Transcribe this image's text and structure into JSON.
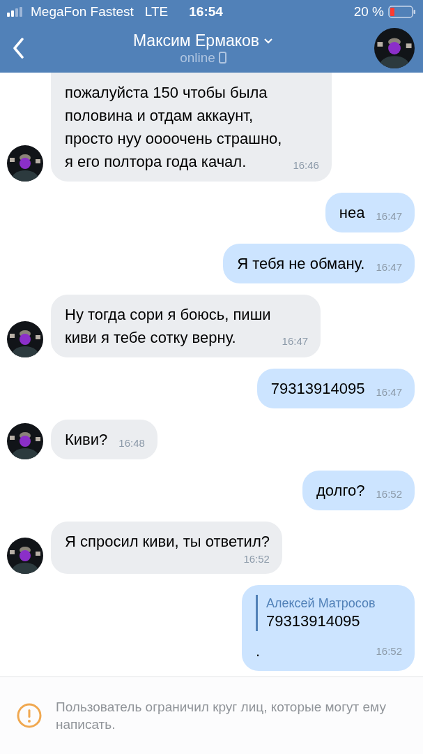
{
  "status_bar": {
    "carrier": "MegaFon Fastest",
    "network": "LTE",
    "time": "16:54",
    "battery": "20 %"
  },
  "header": {
    "title": "Максим Ермаков",
    "status": "online"
  },
  "messages": [
    {
      "outgoing": false,
      "kind": "text",
      "text": "пожалуйста 150 чтобы была\nполовина и отдам аккаунт,\nпросто нуу оооочень страшно,\nя его полтора года качал.",
      "time": "16:46"
    },
    {
      "outgoing": true,
      "kind": "text",
      "text": "неа",
      "time": "16:47"
    },
    {
      "outgoing": true,
      "kind": "text",
      "text": "Я тебя не обману.",
      "time": "16:47"
    },
    {
      "outgoing": false,
      "kind": "text",
      "text": "Ну тогда сори я боюсь, пиши\nкиви я тебе сотку верну.",
      "time": "16:47"
    },
    {
      "outgoing": true,
      "kind": "text",
      "text": "79313914095",
      "time": "16:47"
    },
    {
      "outgoing": false,
      "kind": "text",
      "text": "Киви?",
      "time": "16:48"
    },
    {
      "outgoing": true,
      "kind": "text",
      "text": "долго?",
      "time": "16:52"
    },
    {
      "outgoing": false,
      "kind": "text_below",
      "text": "Я спросил киви, ты ответил?",
      "time": "16:52"
    },
    {
      "outgoing": true,
      "kind": "forward",
      "author": "Алексей Матросов",
      "quote": "79313914095",
      "text": ".",
      "time": "16:52"
    }
  ],
  "footer": {
    "notice": "Пользователь ограничил круг лиц, которые могут ему написать."
  }
}
